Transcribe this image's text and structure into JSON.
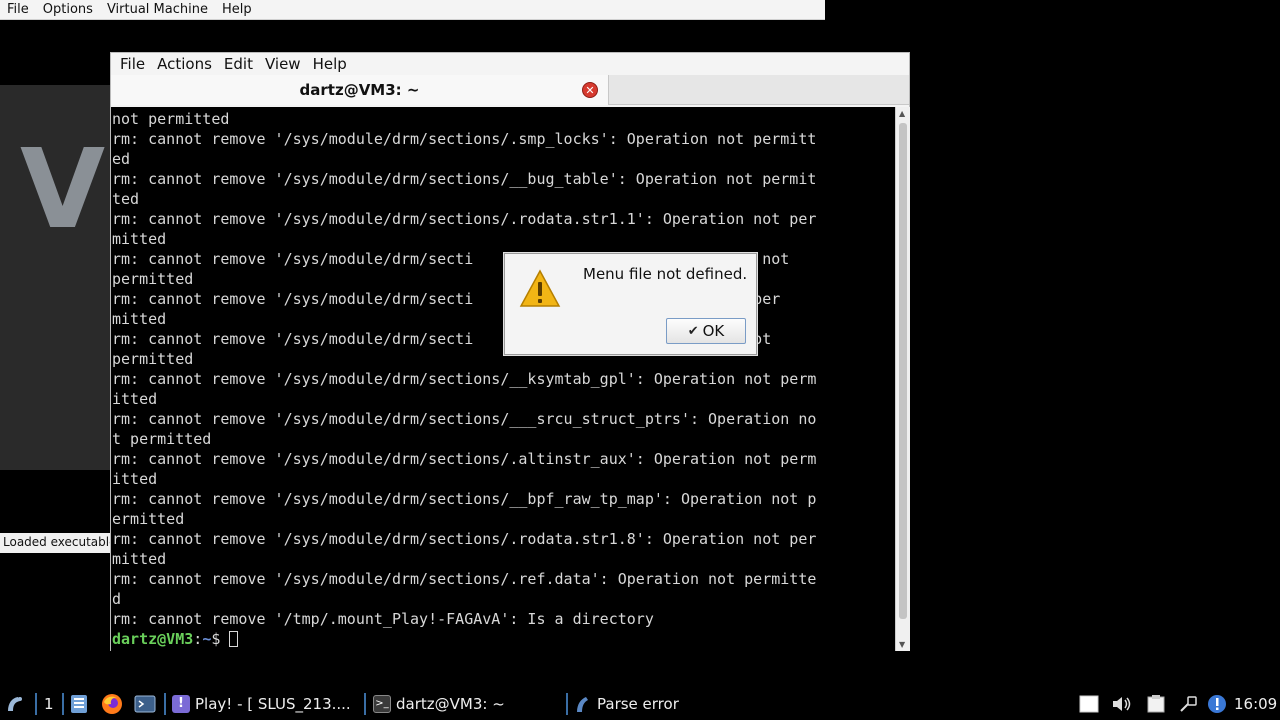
{
  "emulator": {
    "menu": [
      "File",
      "Options",
      "Virtual Machine",
      "Help"
    ],
    "bg_letter": "V",
    "status": "Loaded executable"
  },
  "terminal": {
    "menu": [
      "File",
      "Actions",
      "Edit",
      "View",
      "Help"
    ],
    "tab_title": "dartz@VM3: ~",
    "lines": [
      "not permitted",
      "rm: cannot remove '/sys/module/drm/sections/.smp_locks': Operation not permitt",
      "ed",
      "rm: cannot remove '/sys/module/drm/sections/__bug_table': Operation not permit",
      "ted",
      "rm: cannot remove '/sys/module/drm/sections/.rodata.str1.1': Operation not per",
      "mitted",
      "rm: cannot remove '/sys/module/drm/secti                    : Operation not",
      "permitted",
      "rm: cannot remove '/sys/module/drm/secti                    ration not per",
      "mitted",
      "rm: cannot remove '/sys/module/drm/secti                    Operation not",
      "permitted",
      "rm: cannot remove '/sys/module/drm/sections/__ksymtab_gpl': Operation not perm",
      "itted",
      "rm: cannot remove '/sys/module/drm/sections/___srcu_struct_ptrs': Operation no",
      "t permitted",
      "rm: cannot remove '/sys/module/drm/sections/.altinstr_aux': Operation not perm",
      "itted",
      "rm: cannot remove '/sys/module/drm/sections/__bpf_raw_tp_map': Operation not p",
      "ermitted",
      "rm: cannot remove '/sys/module/drm/sections/.rodata.str1.8': Operation not per",
      "mitted",
      "rm: cannot remove '/sys/module/drm/sections/.ref.data': Operation not permitte",
      "d",
      "rm: cannot remove '/tmp/.mount_Play!-FAGAvA': Is a directory"
    ],
    "prompt_user": "dartz@VM3",
    "prompt_sep": ":",
    "prompt_path": "~",
    "prompt_symbol": "$ "
  },
  "dialog": {
    "message": "Menu file not defined.",
    "ok_label": "OK",
    "icon": "warning-icon"
  },
  "taskbar": {
    "workspace": "1",
    "play_label": "Play! - [ SLUS_213....",
    "terminal_label": "dartz@VM3: ~",
    "parse_label": "Parse error",
    "clock": "16:09"
  }
}
